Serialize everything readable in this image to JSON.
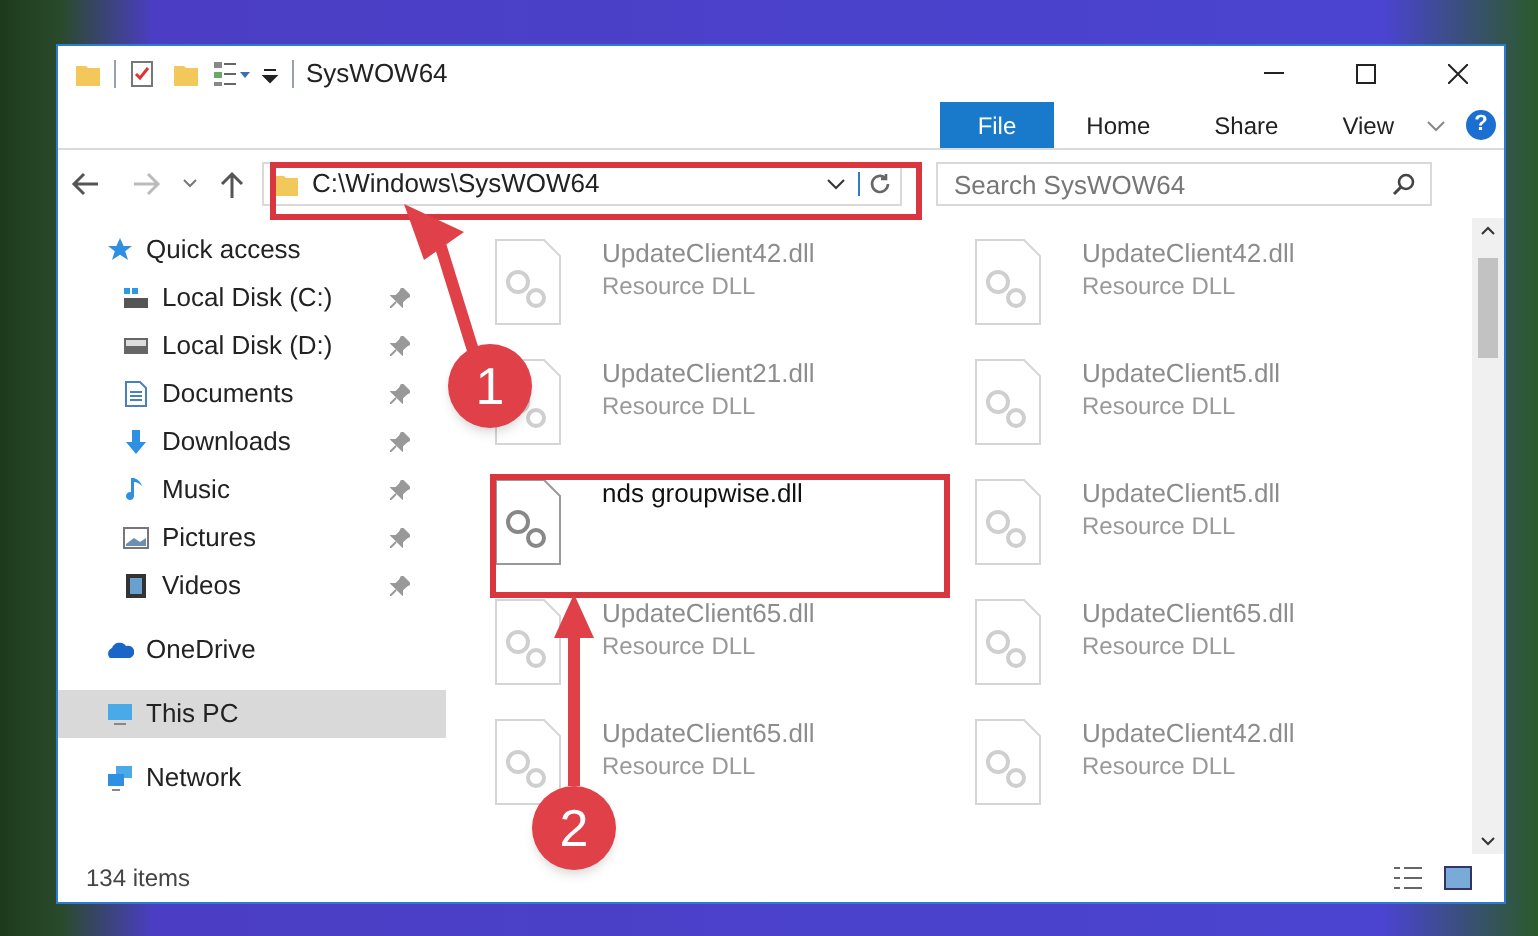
{
  "window": {
    "title": "SysWOW64"
  },
  "ribbon": {
    "tabs": [
      {
        "label": "File",
        "selected": true
      },
      {
        "label": "Home",
        "selected": false
      },
      {
        "label": "Share",
        "selected": false
      },
      {
        "label": "View",
        "selected": false
      }
    ],
    "help_button": "?"
  },
  "address_bar": {
    "path": "C:\\Windows\\SysWOW64"
  },
  "search": {
    "placeholder": "Search SysWOW64"
  },
  "sidebar": {
    "items": [
      {
        "label": "Quick access",
        "selected": false,
        "children": [
          {
            "label": "Local Disk (C:)",
            "selected": false,
            "pinned": true
          },
          {
            "label": "Local Disk (D:)",
            "selected": false,
            "pinned": true
          },
          {
            "label": "Documents",
            "selected": false,
            "pinned": true
          },
          {
            "label": "Downloads",
            "selected": false,
            "pinned": true
          },
          {
            "label": "Music",
            "selected": false,
            "pinned": true
          },
          {
            "label": "Pictures",
            "selected": false,
            "pinned": true
          },
          {
            "label": "Videos",
            "selected": false,
            "pinned": true
          }
        ]
      },
      {
        "label": "OneDrive",
        "selected": false
      },
      {
        "label": "This PC",
        "selected": true
      },
      {
        "label": "Network",
        "selected": false
      }
    ]
  },
  "files": [
    {
      "name": "UpdateClient42.dll",
      "type": "Resource DLL"
    },
    {
      "name": "UpdateClient42.dll",
      "type": "Resource DLL"
    },
    {
      "name": "UpdateClient21.dll",
      "type": "Resource DLL"
    },
    {
      "name": "UpdateClient5.dll",
      "type": "Resource DLL"
    },
    {
      "name": "nds groupwise.dll"
    },
    {
      "name": "UpdateClient5.dll",
      "type": "Resource DLL"
    },
    {
      "name": "UpdateClient65.dll",
      "type": "Resource DLL"
    },
    {
      "name": "UpdateClient65.dll",
      "type": "Resource DLL"
    },
    {
      "name": "UpdateClient65.dll",
      "type": "Resource DLL"
    },
    {
      "name": "UpdateClient42.dll",
      "type": "Resource DLL"
    }
  ],
  "status_bar": {
    "item_count": "134 items"
  },
  "annotations": [
    {
      "number": "1"
    },
    {
      "number": "2"
    }
  ]
}
